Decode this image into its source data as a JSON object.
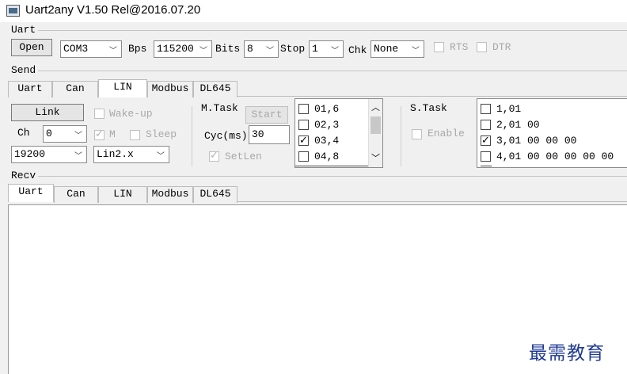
{
  "window": {
    "title": "Uart2any V1.50 Rel@2016.07.20"
  },
  "uart": {
    "group_label": "Uart",
    "open_label": "Open",
    "port": "COM3",
    "bps_label": "Bps",
    "bps": "115200",
    "bits_label": "Bits",
    "bits": "8",
    "stop_label": "Stop",
    "stop": "1",
    "chk_label": "Chk",
    "chk": "None",
    "rts_label": "RTS",
    "dtr_label": "DTR"
  },
  "send": {
    "group_label": "Send",
    "tabs": [
      "Uart",
      "Can",
      "LIN",
      "Modbus",
      "DL645"
    ],
    "active_tab": "LIN",
    "link_label": "Link",
    "wakeup_label": "Wake-up",
    "ch_label": "Ch",
    "ch": "0",
    "m_label": "M",
    "sleep_label": "Sleep",
    "baud": "19200",
    "lin_version": "Lin2.x",
    "mtask_label": "M.Task",
    "start_label": "Start",
    "cyc_label": "Cyc(ms)",
    "cyc": "30",
    "setlen_label": "SetLen",
    "mtask_items": [
      {
        "text": "01,6",
        "checked": false
      },
      {
        "text": "02,3",
        "checked": false
      },
      {
        "text": "03,4",
        "checked": true
      },
      {
        "text": "04,8",
        "checked": false
      }
    ],
    "stask_label": "S.Task",
    "enable_label": "Enable",
    "stask_items": [
      {
        "text": "1,01",
        "checked": false
      },
      {
        "text": "2,01 00",
        "checked": false
      },
      {
        "text": "3,01 00 00 00",
        "checked": true
      },
      {
        "text": "4,01 00 00 00 00 00",
        "checked": false
      }
    ]
  },
  "recv": {
    "group_label": "Recv",
    "tabs": [
      "Uart",
      "Can",
      "LIN",
      "Modbus",
      "DL645"
    ],
    "active_tab": "Uart"
  },
  "watermark": "最需教育"
}
